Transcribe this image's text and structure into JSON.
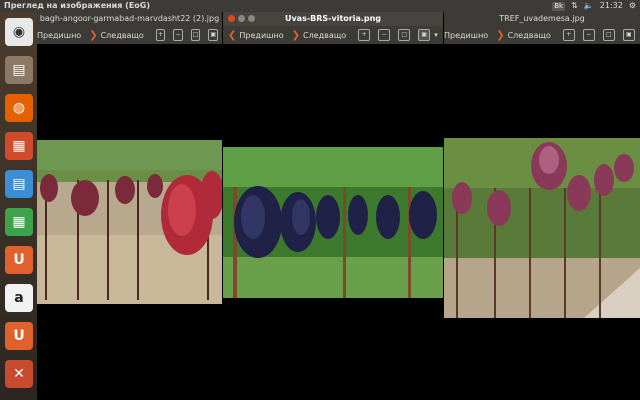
{
  "panel": {
    "title": "Преглед на изображения (EoG)",
    "keyboard": "Bk",
    "time": "21:32"
  },
  "launcher": {
    "items": [
      {
        "name": "ubuntu-dash-icon",
        "color": "#f0f0f0"
      },
      {
        "name": "files-icon",
        "color": "#a0826b"
      },
      {
        "name": "firefox-icon",
        "color": "#e66000"
      },
      {
        "name": "impress-icon",
        "color": "#d04b2a"
      },
      {
        "name": "writer-icon",
        "color": "#3a8fd6"
      },
      {
        "name": "calc-icon",
        "color": "#3da34a"
      },
      {
        "name": "ubuntu-one-icon",
        "color": "#e0612c"
      },
      {
        "name": "amazon-icon",
        "color": "#f2f2f2"
      },
      {
        "name": "ubuntu-one-music-icon",
        "color": "#e0612c"
      },
      {
        "name": "system-settings-icon",
        "color": "#c94b2d"
      }
    ]
  },
  "windows": [
    {
      "title": "bagh-angoor-garmabad-marvdasht22 (2).jpg",
      "prev": "Предишно",
      "next": "Следващо"
    },
    {
      "title": "Uvas-BRS-vitoria.png",
      "prev": "Предишно",
      "next": "Следващо"
    },
    {
      "title": "TREF_uvademesa.jpg",
      "prev": "Предишно",
      "next": "Следващо"
    }
  ]
}
